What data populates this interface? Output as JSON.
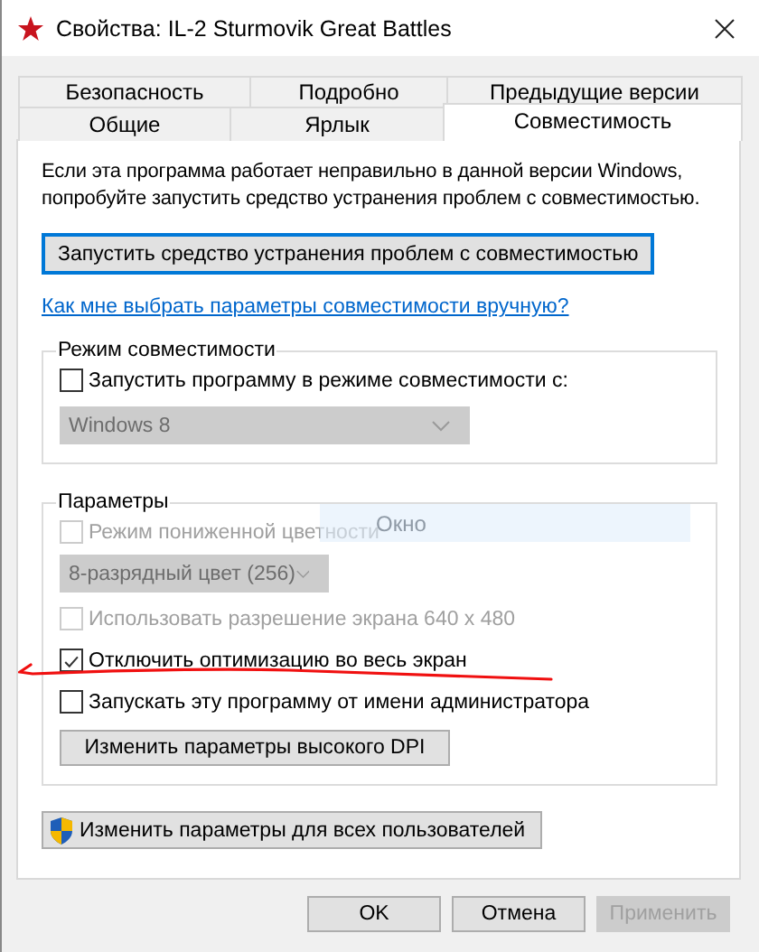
{
  "window": {
    "title": "Свойства: IL-2 Sturmovik Great Battles"
  },
  "tab_rows": [
    {
      "tabs": [
        {
          "label": "Безопасность",
          "selected": false
        },
        {
          "label": "Подробно",
          "selected": false
        },
        {
          "label": "Предыдущие версии",
          "selected": false
        }
      ]
    },
    {
      "tabs": [
        {
          "label": "Общие",
          "selected": false
        },
        {
          "label": "Ярлык",
          "selected": false
        },
        {
          "label": "Совместимость",
          "selected": true
        }
      ]
    }
  ],
  "intro": "Если эта программа работает неправильно в данной версии Windows, попробуйте запустить средство устранения проблем с совместимостью.",
  "troubleshoot_button": {
    "label": "Запустить средство устранения проблем с совместимостью",
    "focused": true
  },
  "help_link": "Как мне выбрать параметры совместимости вручную?",
  "groups": [
    {
      "title": "Режим совместимости",
      "items": [
        {
          "kind": "checkbox",
          "label": "Запустить программу в режиме совместимости с:",
          "checked": false,
          "disabled": false
        },
        {
          "kind": "dropdown",
          "value": "Windows 8",
          "disabled": true
        }
      ]
    },
    {
      "title": "Параметры",
      "items": [
        {
          "kind": "checkbox",
          "label": "Режим пониженной цветности",
          "checked": false,
          "disabled": true
        },
        {
          "kind": "dropdown",
          "value": "8-разрядный цвет (256)",
          "disabled": true
        },
        {
          "kind": "checkbox",
          "label": "Использовать разрешение экрана 640 x 480",
          "checked": false,
          "disabled": true
        },
        {
          "kind": "checkbox",
          "label": "Отключить оптимизацию во весь экран",
          "checked": true,
          "disabled": false
        },
        {
          "kind": "checkbox",
          "label": "Запускать эту программу от имени администратора",
          "checked": false,
          "disabled": false
        },
        {
          "kind": "button",
          "label": "Изменить параметры высокого DPI",
          "disabled": false
        }
      ]
    }
  ],
  "all_users_button": {
    "label": "Изменить параметры для всех пользователей"
  },
  "tooltip": {
    "text": "Окно"
  },
  "buttons": [
    {
      "label": "OK",
      "disabled": false
    },
    {
      "label": "Отмена",
      "disabled": false
    },
    {
      "label": "Применить",
      "disabled": true
    }
  ]
}
